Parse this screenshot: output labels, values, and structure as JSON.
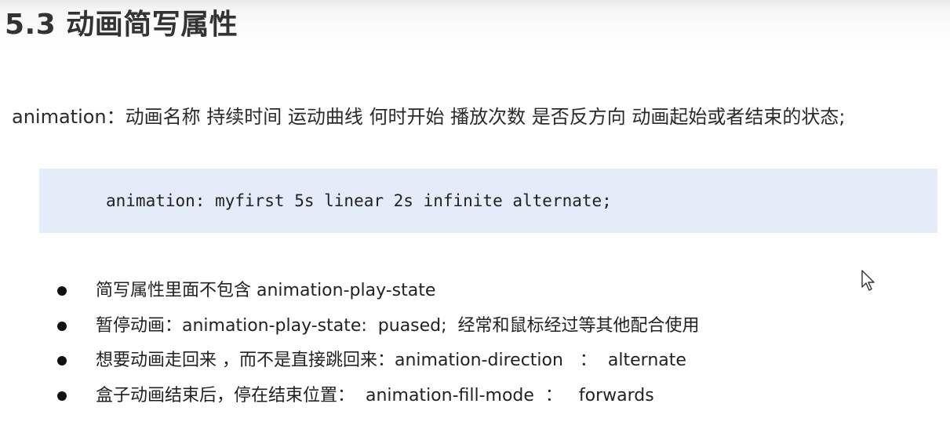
{
  "title": "5.3 动画简写属性",
  "syntax": "animation：动画名称 持续时间 运动曲线  何时开始  播放次数  是否反方向  动画起始或者结束的状态;",
  "code": "animation: myfirst 5s linear 2s infinite alternate;",
  "colors": {
    "code_background": "#e4ecf9",
    "title_text": "#333333"
  },
  "bullets": [
    {
      "text": "简写属性里面不包含 animation-play-state"
    },
    {
      "text": "暂停动画：animation-play-state:  puased;  经常和鼠标经过等其他配合使用"
    },
    {
      "text": "想要动画走回来 ，而不是直接跳回来：animation-direction   ：  alternate"
    },
    {
      "text": "盒子动画结束后，停在结束位置：  animation-fill-mode  ：   forwards"
    }
  ],
  "cursor_icon": "mouse-pointer-icon"
}
